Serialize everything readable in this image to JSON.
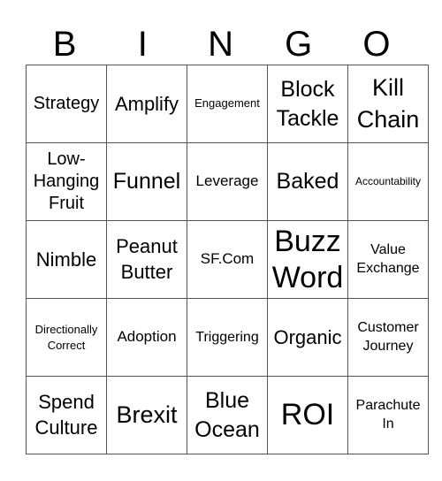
{
  "header": {
    "letters": [
      "B",
      "I",
      "N",
      "G",
      "O"
    ]
  },
  "grid": {
    "rows": [
      [
        "Strategy",
        "Amplify",
        "Engagement",
        "Block Tackle",
        "Kill Chain"
      ],
      [
        "Low-Hanging Fruit",
        "Funnel",
        "Leverage",
        "Baked",
        "Accountability"
      ],
      [
        "Nimble",
        "Peanut Butter",
        "SF.Com",
        "Buzz Word",
        "Value Exchange"
      ],
      [
        "Directionally Correct",
        "Adoption",
        "Triggering",
        "Organic",
        "Customer Journey"
      ],
      [
        "Spend Culture",
        "Brexit",
        "Blue Ocean",
        "ROI",
        "Parachute In"
      ]
    ]
  }
}
